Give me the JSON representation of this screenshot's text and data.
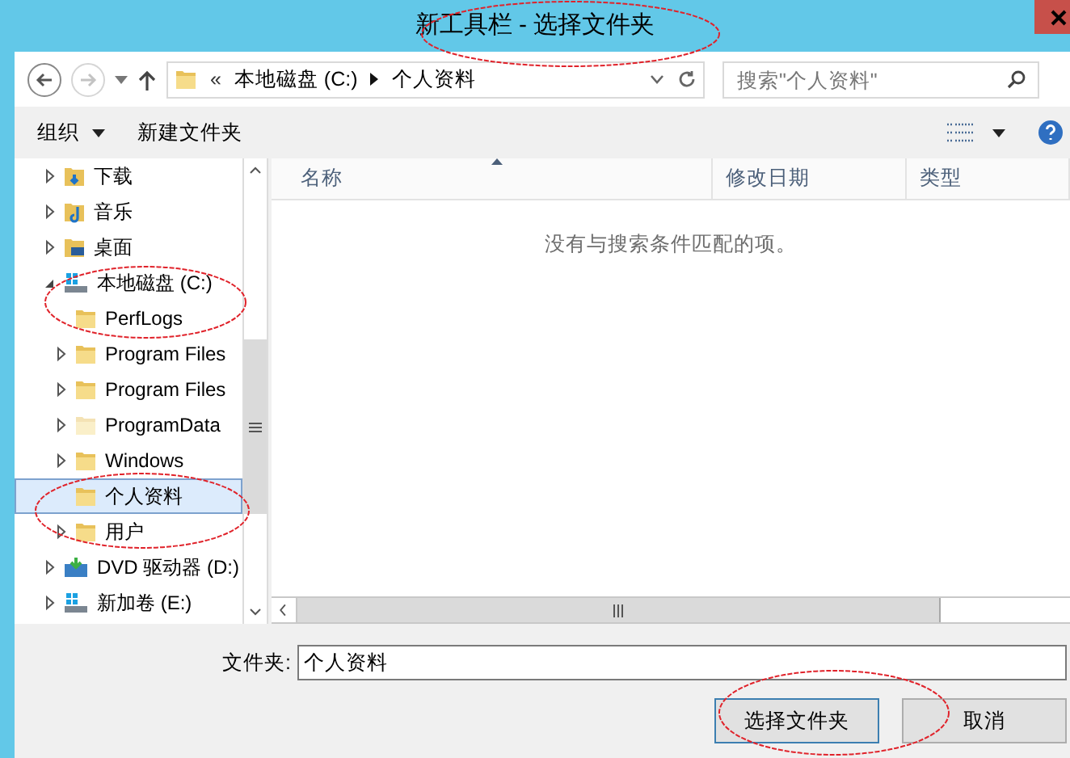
{
  "window": {
    "title": "新工具栏 - 选择文件夹"
  },
  "navigation": {
    "back_enabled": true,
    "forward_enabled": false
  },
  "address_bar": {
    "overflow": "«",
    "segments": [
      "本地磁盘 (C:)",
      "个人资料"
    ]
  },
  "search": {
    "placeholder": "搜索\"个人资料\""
  },
  "toolbar": {
    "items": [
      {
        "label": "组织",
        "kind": "menu"
      },
      {
        "label": "新建文件夹",
        "kind": "button"
      }
    ]
  },
  "tree": [
    {
      "label": "下载",
      "kind": "download-folder",
      "expandable": true,
      "expanded": false,
      "selected": false
    },
    {
      "label": "音乐",
      "kind": "music-folder",
      "expandable": true,
      "expanded": false,
      "selected": false
    },
    {
      "label": "桌面",
      "kind": "desktop-folder",
      "expandable": true,
      "expanded": false,
      "selected": false
    },
    {
      "label": "本地磁盘 (C:)",
      "kind": "drive",
      "expandable": true,
      "expanded": true,
      "selected": false,
      "children": [
        {
          "label": "PerfLogs",
          "kind": "folder",
          "expandable": false,
          "selected": false
        },
        {
          "label": "Program Files",
          "kind": "folder",
          "expandable": true,
          "expanded": false,
          "selected": false
        },
        {
          "label": "Program Files",
          "kind": "folder",
          "expandable": true,
          "expanded": false,
          "selected": false
        },
        {
          "label": "ProgramData",
          "kind": "hidden-folder",
          "expandable": true,
          "expanded": false,
          "selected": false
        },
        {
          "label": "Windows",
          "kind": "folder",
          "expandable": true,
          "expanded": false,
          "selected": false
        },
        {
          "label": "个人资料",
          "kind": "folder",
          "expandable": false,
          "selected": true
        },
        {
          "label": "用户",
          "kind": "folder",
          "expandable": true,
          "expanded": false,
          "selected": false
        }
      ]
    },
    {
      "label": "DVD 驱动器 (D:)",
      "kind": "dvd",
      "expandable": true,
      "expanded": false,
      "selected": false
    },
    {
      "label": "新加卷 (E:)",
      "kind": "drive",
      "expandable": true,
      "expanded": false,
      "selected": false
    }
  ],
  "columns": [
    {
      "label": "名称",
      "sorted": true
    },
    {
      "label": "修改日期",
      "sorted": false
    },
    {
      "label": "类型",
      "sorted": false
    }
  ],
  "empty_message": "没有与搜索条件匹配的项。",
  "folder_field": {
    "label": "文件夹:",
    "value": "个人资料"
  },
  "buttons": [
    {
      "label": "选择文件夹",
      "kind": "primary"
    },
    {
      "label": "取消",
      "kind": "secondary"
    }
  ]
}
